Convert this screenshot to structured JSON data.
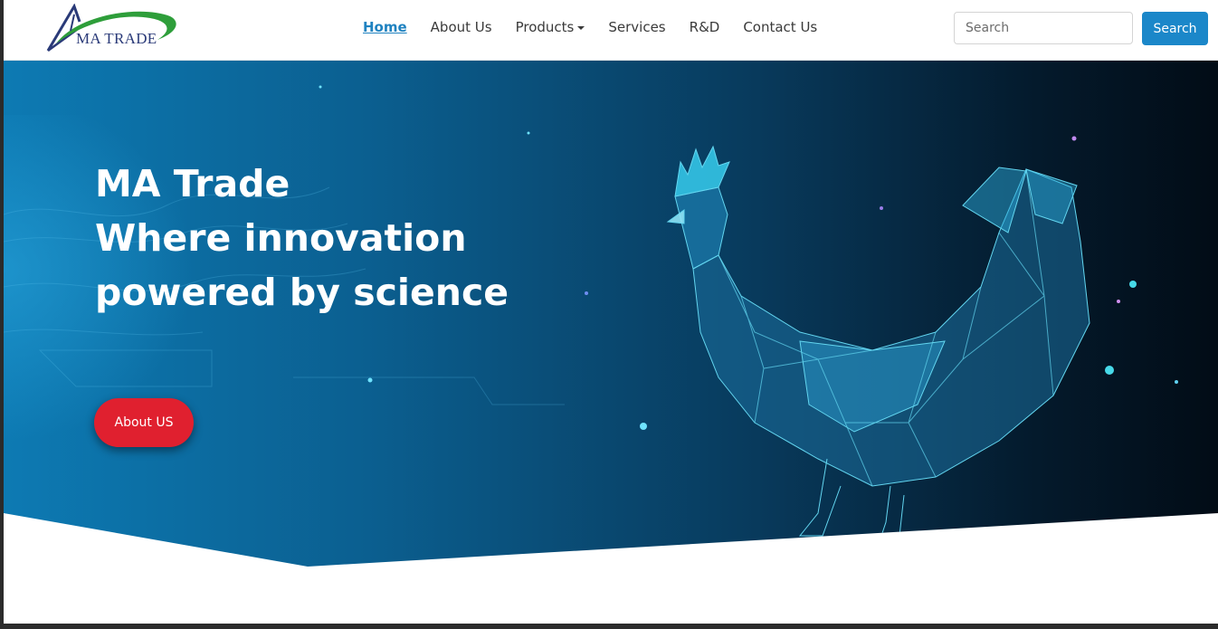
{
  "brand": {
    "logo_text": "MA TRADE"
  },
  "nav": {
    "items": [
      {
        "label": "Home",
        "active": true
      },
      {
        "label": "About Us"
      },
      {
        "label": "Products",
        "dropdown": true
      },
      {
        "label": "Services"
      },
      {
        "label": "R&D"
      },
      {
        "label": "Contact Us"
      }
    ]
  },
  "search": {
    "placeholder": "Search",
    "button_label": "Search"
  },
  "hero": {
    "title_lines": [
      "MA Trade",
      "Where innovation",
      "powered by science"
    ],
    "cta_label": "About US"
  },
  "colors": {
    "accent_blue": "#1b87c9",
    "cta_red": "#e0202f",
    "hero_dark": "#020c16"
  },
  "icons": [
    "logo-swoosh-icon",
    "caret-down-icon",
    "rooster-illustration"
  ]
}
